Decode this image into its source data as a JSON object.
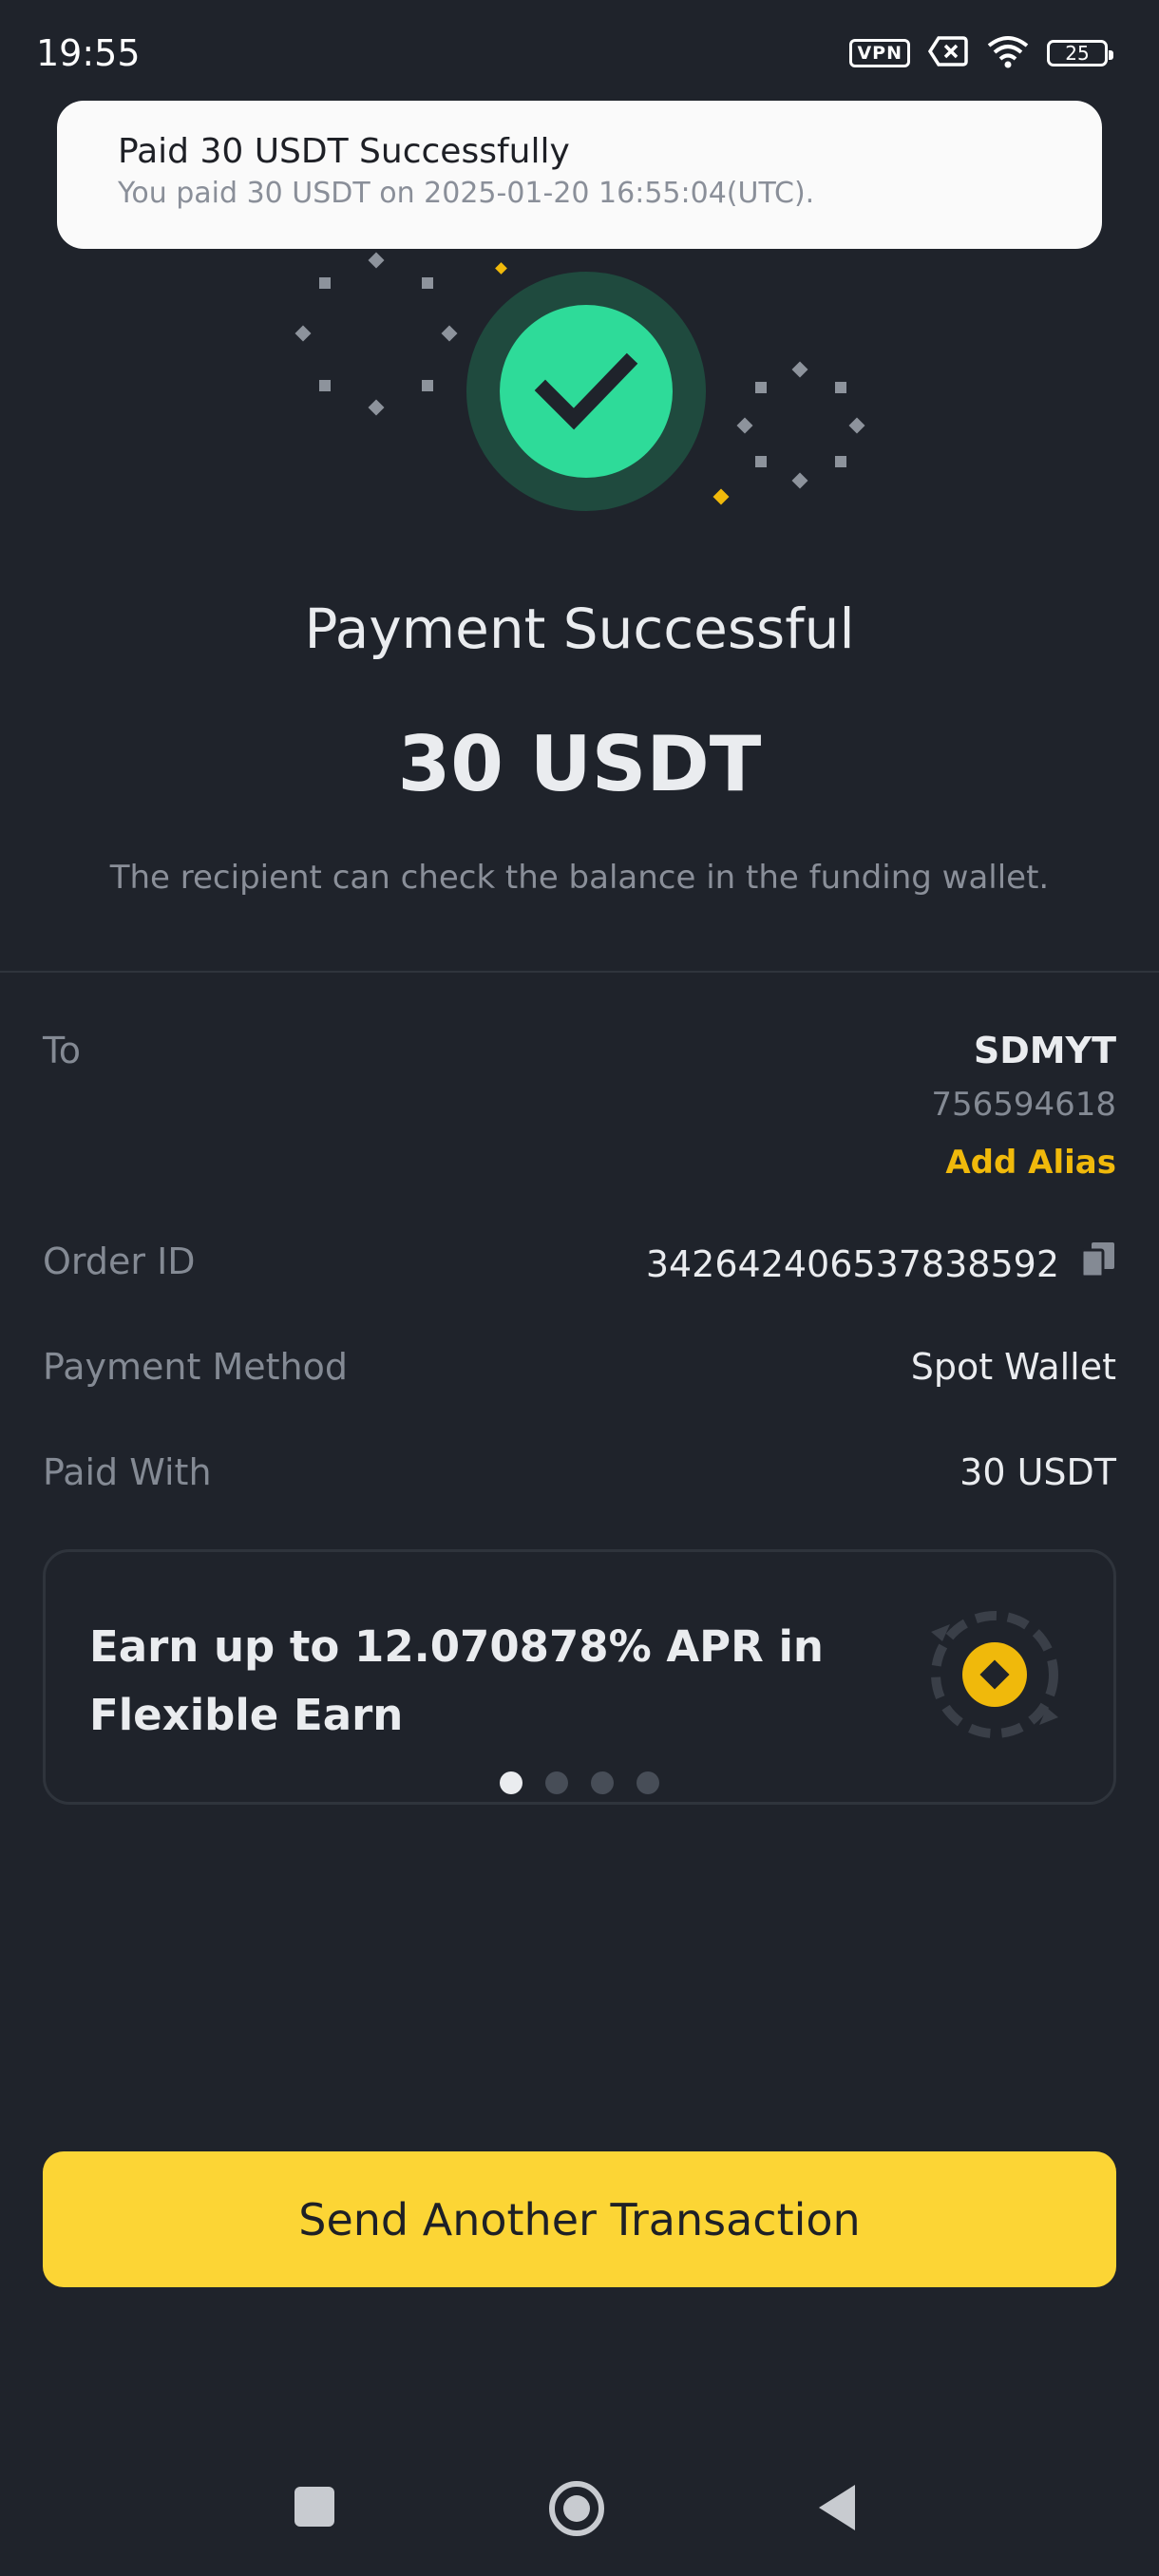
{
  "status_bar": {
    "time": "19:55",
    "vpn": "VPN",
    "battery": "25"
  },
  "toast": {
    "title": "Paid 30 USDT Successfully",
    "subtitle": "You paid 30 USDT on 2025-01-20 16:55:04(UTC)."
  },
  "result": {
    "title": "Payment Successful",
    "amount": "30 USDT",
    "note": "The recipient can check the balance in the funding wallet."
  },
  "details": {
    "to_label": "To",
    "to_name": "SDMYT",
    "to_id": "756594618",
    "add_alias": "Add Alias",
    "order_id_label": "Order ID",
    "order_id": "342642406537838592",
    "payment_method_label": "Payment Method",
    "payment_method": "Spot Wallet",
    "paid_with_label": "Paid With",
    "paid_with": "30 USDT"
  },
  "promo": {
    "line1": "Earn up to 12.070878% APR in",
    "line2": "Flexible Earn",
    "pages": 4,
    "active_page": 1
  },
  "cta_label": "Send Another Transaction",
  "colors": {
    "accent": "#fcd535",
    "success": "#2edb99",
    "background": "#1f232b"
  },
  "icons": [
    "vpn-icon",
    "sim-off-icon",
    "wifi-icon",
    "battery-icon",
    "checkmark-icon",
    "copy-icon",
    "flexible-earn-icon",
    "home-square-icon",
    "home-circle-icon",
    "back-triangle-icon"
  ]
}
